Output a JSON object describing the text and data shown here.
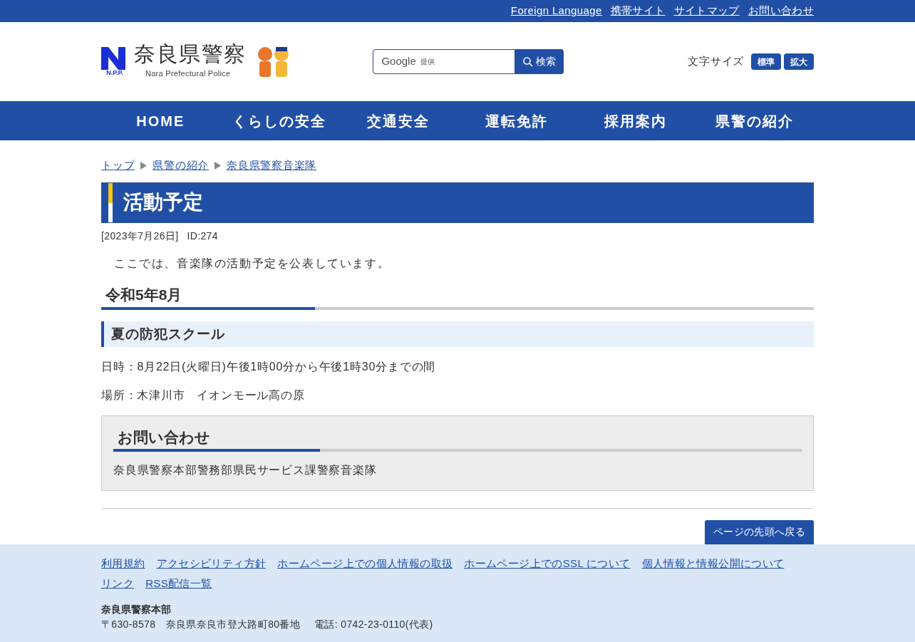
{
  "top_links": [
    "Foreign Language",
    "携帯サイト",
    "サイトマップ",
    "お問い合わせ"
  ],
  "logo": {
    "title": "奈良県警察",
    "subtitle": "Nara Prefectural Police",
    "mark": "N.P.P."
  },
  "search": {
    "provider": "Google",
    "provider_note": "提供",
    "button": "検索"
  },
  "font_size": {
    "label": "文字サイズ",
    "buttons": [
      "標準",
      "拡大"
    ]
  },
  "nav": [
    "HOME",
    "くらしの安全",
    "交通安全",
    "運転免許",
    "採用案内",
    "県警の紹介"
  ],
  "breadcrumb": [
    "トップ",
    "県警の紹介",
    "奈良県警察音楽隊"
  ],
  "page_title": "活動予定",
  "meta": {
    "date": "[2023年7月26日]",
    "id": "ID:274"
  },
  "intro": "ここでは、音楽隊の活動予定を公表しています。",
  "section": {
    "heading": "令和5年8月",
    "subheading": "夏の防犯スクール",
    "lines": [
      "日時：8月22日(火曜日)午後1時00分から午後1時30分までの間",
      "場所：木津川市　イオンモール高の原"
    ]
  },
  "contact": {
    "heading": "お問い合わせ",
    "text": "奈良県警察本部警務部県民サービス課警察音楽隊"
  },
  "back_to_top": "ページの先頭へ戻る",
  "footer": {
    "links": [
      "利用規約",
      "アクセシビリティ方針",
      "ホームページ上での個人情報の取扱",
      "ホームページ上でのSSL について",
      "個人情報と情報公開について",
      "リンク",
      "RSS配信一覧"
    ],
    "org": "奈良県警察本部",
    "address": "〒630-8578　奈良県奈良市登大路町80番地",
    "phone": "電話: 0742-23-0110(代表)"
  }
}
